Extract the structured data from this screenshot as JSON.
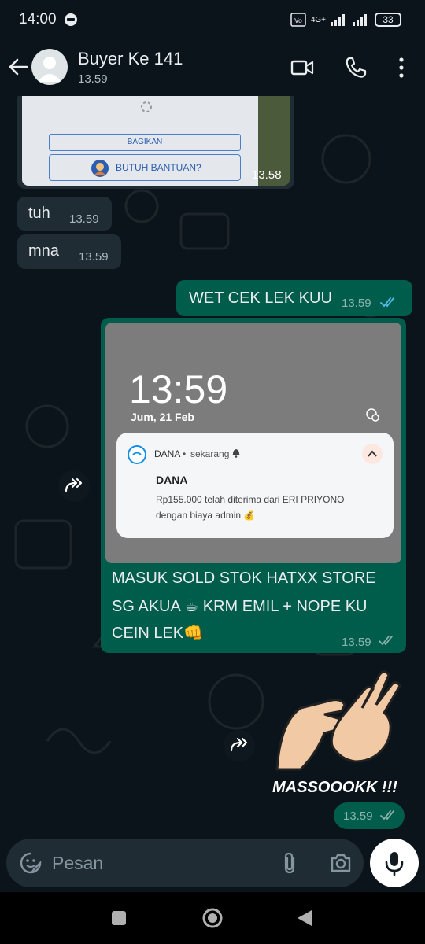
{
  "status_bar": {
    "time": "14:00",
    "network": "4G+",
    "battery": "33"
  },
  "header": {
    "name": "Buyer Ke 141",
    "status": "13.59"
  },
  "messages": {
    "image_msg": {
      "share_label": "BAGIKAN",
      "help_label": "BUTUH BANTUAN?",
      "time": "13.58"
    },
    "tuh": {
      "text": "tuh",
      "time": "13.59"
    },
    "mna": {
      "text": "mna",
      "time": "13.59"
    },
    "wet": {
      "text": "WET CEK LEK KUU",
      "time": "13.59"
    },
    "screenshot": {
      "clock": "13:59",
      "date": "Jum, 21 Feb",
      "notif_app": "DANA",
      "notif_when": "sekarang",
      "notif_title": "DANA",
      "notif_body_1": "Rp155.000 telah diterima dari ERI PRIYONO",
      "notif_body_2": "dengan biaya admin 💰",
      "caption_1": "MASUK  SOLD STOK HATXX STORE",
      "caption_2": "SG AKUA ☕ KRM EMIL + NOPE KU",
      "caption_3": "CEIN LEK👊",
      "time": "13.59"
    },
    "sticker": {
      "text": "MASSOOOKK !!!",
      "time": "13.59"
    }
  },
  "input": {
    "placeholder": "Pesan"
  },
  "colors": {
    "background": "#0b141a",
    "incoming": "#202c33",
    "outgoing": "#005c4b",
    "read_tick": "#53bdeb"
  }
}
